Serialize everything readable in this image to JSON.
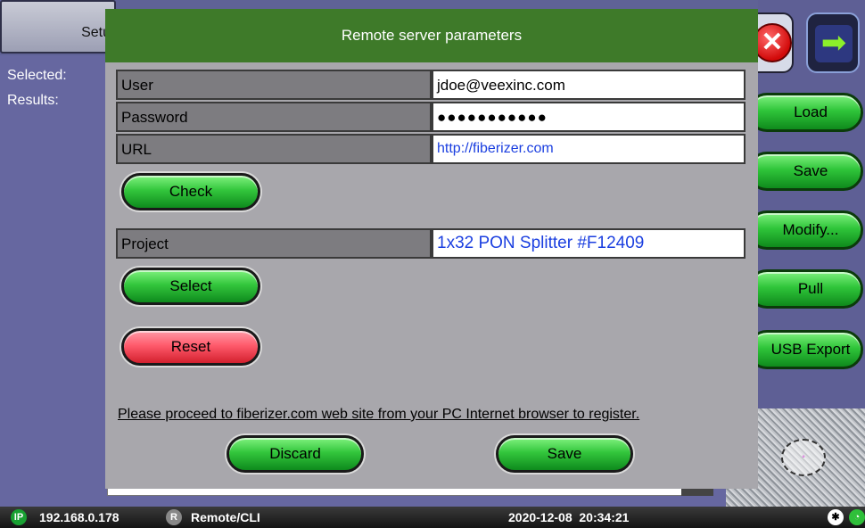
{
  "background": {
    "tab_label": "Setu",
    "selected_label": "Selected:",
    "results_label": "Results:"
  },
  "side_buttons": {
    "load": "Load",
    "save": "Save",
    "modify": "Modify...",
    "pull": "Pull",
    "usb_export": "USB Export"
  },
  "dialog": {
    "title": "Remote server parameters",
    "fields": {
      "user": {
        "label": "User",
        "value": "jdoe@veexinc.com"
      },
      "password": {
        "label": "Password",
        "value": "●●●●●●●●●●●"
      },
      "url": {
        "label": "URL",
        "value": "http://fiberizer.com"
      },
      "project": {
        "label": "Project",
        "value": "1x32 PON Splitter #F12409"
      }
    },
    "buttons": {
      "check": "Check",
      "select": "Select",
      "reset": "Reset",
      "discard": "Discard",
      "save": "Save"
    },
    "note": "Please proceed to fiberizer.com web site from your PC Internet browser to register."
  },
  "status_bar": {
    "ip_badge": "IP",
    "ip_address": "192.168.0.178",
    "remote_badge": "R",
    "remote_label": "Remote/CLI",
    "datetime": "2020-12-08  20:34:21"
  },
  "colors": {
    "dialog_header": "#3e7a29",
    "button_green": "#33c63c",
    "button_red": "#ff5b6c",
    "link_blue": "#1b3fe0"
  },
  "icons": {
    "close": "close-icon",
    "next": "arrow-right-icon",
    "bluetooth": "bluetooth-icon",
    "wifi": "wifi-icon"
  }
}
